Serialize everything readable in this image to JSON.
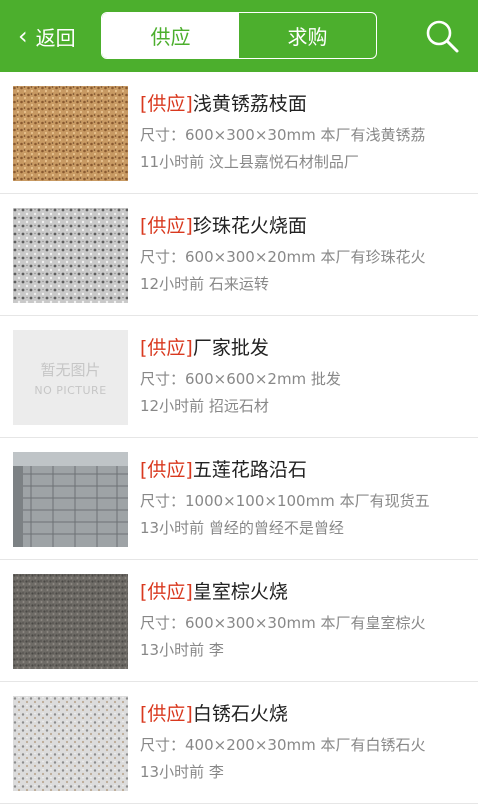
{
  "header": {
    "back_label": "返回",
    "tabs": [
      {
        "label": "供应",
        "active": true
      },
      {
        "label": "求购",
        "active": false
      }
    ],
    "search_icon": "search-icon",
    "accent": "#4caf2d"
  },
  "listing": {
    "tag_color": "#d9391f",
    "items": [
      {
        "tag": "[供应]",
        "title": "浅黄锈荔枝面",
        "spec": "尺寸：600×300×30mm 本厂有浅黄锈荔",
        "meta": "11小时前 汶上县嘉悦石材制品厂",
        "image": "granite-yellow-rust"
      },
      {
        "tag": "[供应]",
        "title": "珍珠花火烧面",
        "spec": "尺寸：600×300×20mm 本厂有珍珠花火",
        "meta": "12小时前 石来运转",
        "image": "granite-pearl-flower"
      },
      {
        "tag": "[供应]",
        "title": "厂家批发",
        "spec": "尺寸：600×600×2mm 批发",
        "meta": "12小时前 招远石材",
        "image": "no-picture",
        "nopic_cn": "暂无图片",
        "nopic_en": "NO PICTURE"
      },
      {
        "tag": "[供应]",
        "title": "五莲花路沿石",
        "spec": "尺寸：1000×100×100mm 本厂有现货五",
        "meta": "13小时前 曾经的曾经不是曾经",
        "image": "curbstone-stack"
      },
      {
        "tag": "[供应]",
        "title": "皇室棕火烧",
        "spec": "尺寸：600×300×30mm 本厂有皇室棕火",
        "meta": "13小时前 李",
        "image": "granite-royal-brown"
      },
      {
        "tag": "[供应]",
        "title": "白锈石火烧",
        "spec": "尺寸：400×200×30mm 本厂有白锈石火",
        "meta": "13小时前 李",
        "image": "granite-white-rust"
      }
    ]
  }
}
